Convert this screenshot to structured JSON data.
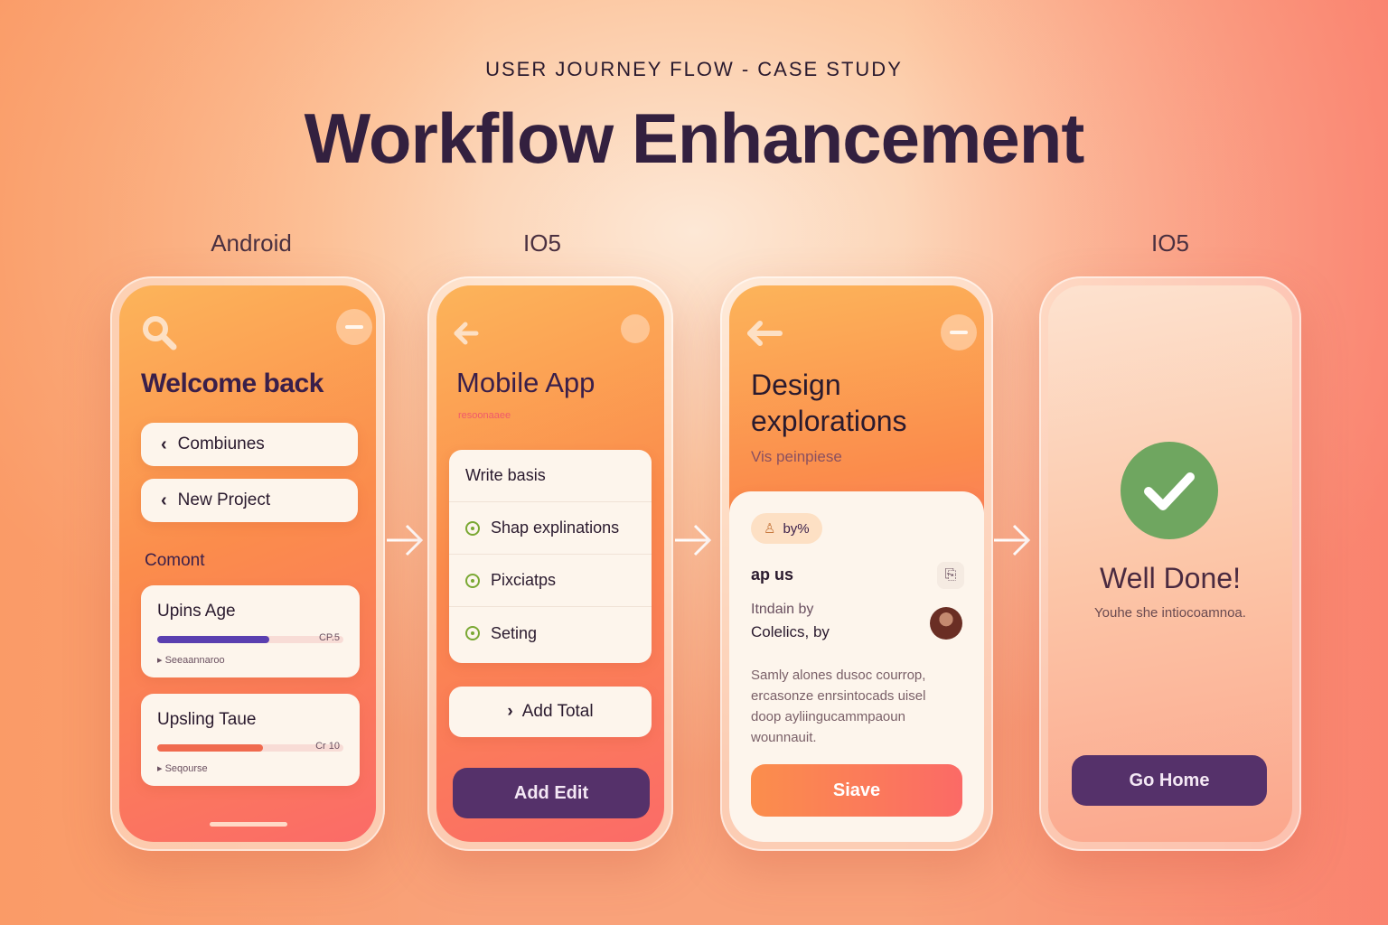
{
  "header": {
    "eyebrow": "USER JOURNEY FLOW - CASE STUDY",
    "title": "Workflow Enhancement"
  },
  "platforms": {
    "p1": "Android",
    "p2": "IO5",
    "p4": "IO5"
  },
  "screen1": {
    "title": "Welcome back",
    "buttons": [
      "Combiunes",
      "New Project"
    ],
    "section_label": "Comont",
    "cards": [
      {
        "title": "Upins Age",
        "value_label": "CP.5",
        "caption": "Seeaannaroo",
        "progress": 0.6,
        "color": "#5a3fb0"
      },
      {
        "title": "Upsling Taue",
        "value_label": "Cr 10",
        "caption": "Seqourse",
        "progress": 0.57,
        "color": "#f06a4e"
      }
    ]
  },
  "screen2": {
    "title": "Mobile App",
    "subtitle": "resoonaaee",
    "list": [
      "Write basis",
      "Shap explinations",
      "Pixciatрs",
      "Seting"
    ],
    "add_button": "Add Total",
    "primary_button": "Add Edit"
  },
  "screen3": {
    "title_line1": "Design",
    "title_line2": "explorations",
    "subtitle": "Vis peinpiese",
    "chip": "by%",
    "heading": "ap us",
    "meta_line1": "Itndain by",
    "meta_line2": "Colelics, by",
    "body": "Samly alones dusoc courrop, ercasonze enrsintocads uisel doop ayliingucammpaoun wounnauit.",
    "primary_button": "Siave"
  },
  "screen4": {
    "title": "Well Done!",
    "subtitle": "Youhe she intiocoamnoa.",
    "primary_button": "Go Home"
  },
  "colors": {
    "accent_purple": "#55316a",
    "success_green": "#6fa660",
    "title_dark": "#33203f"
  },
  "icons": {
    "search": "search-icon",
    "back": "back-arrow-icon",
    "menu": "minus-icon",
    "check": "checkmark-icon"
  }
}
